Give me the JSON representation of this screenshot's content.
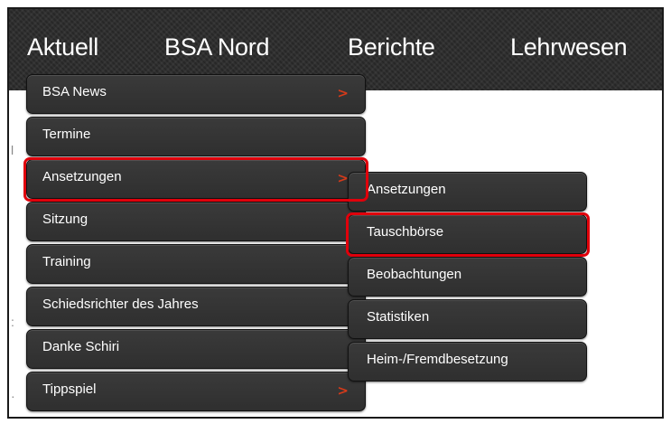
{
  "nav": {
    "items": [
      "Aktuell",
      "BSA Nord",
      "Berichte",
      "Lehrwesen"
    ]
  },
  "main_menu": {
    "items": [
      {
        "label": "BSA News",
        "arrow": ">"
      },
      {
        "label": "Termine"
      },
      {
        "label": "Ansetzungen",
        "arrow": ">"
      },
      {
        "label": "Sitzung"
      },
      {
        "label": "Training"
      },
      {
        "label": "Schiedsrichter des Jahres"
      },
      {
        "label": "Danke Schiri"
      },
      {
        "label": "Tippspiel",
        "arrow": ">"
      }
    ]
  },
  "sub_menu": {
    "items": [
      {
        "label": "Ansetzungen"
      },
      {
        "label": "Tauschbörse"
      },
      {
        "label": "Beobachtungen"
      },
      {
        "label": "Statistiken"
      },
      {
        "label": "Heim-/Fremdbesetzung"
      }
    ]
  },
  "highlight_color": "#e0000b",
  "arrow_color": "#d53a1a",
  "navbar_color": "#2b2b2b"
}
